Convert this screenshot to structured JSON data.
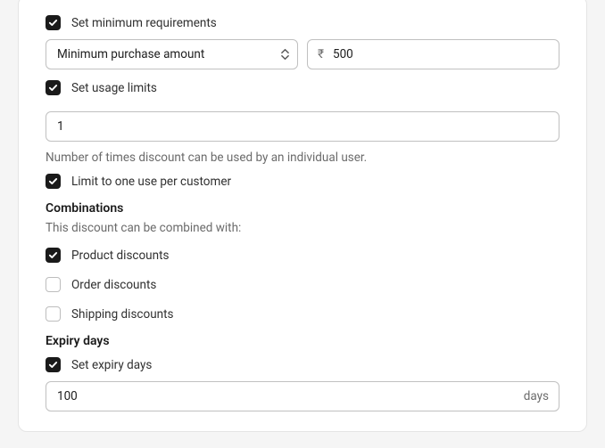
{
  "min_requirements": {
    "label": "Set minimum requirements",
    "checked": true,
    "select_value": "Minimum purchase amount",
    "currency_symbol": "₹",
    "amount": "500"
  },
  "usage_limits": {
    "label": "Set usage limits",
    "checked": true,
    "value": "1",
    "help": "Number of times discount can be used by an individual user."
  },
  "limit_one": {
    "label": "Limit to one use per customer",
    "checked": true
  },
  "combinations": {
    "title": "Combinations",
    "subtitle": "This discount can be combined with:",
    "items": [
      {
        "label": "Product discounts",
        "checked": true
      },
      {
        "label": "Order discounts",
        "checked": false
      },
      {
        "label": "Shipping discounts",
        "checked": false
      }
    ]
  },
  "expiry": {
    "title": "Expiry days",
    "set_label": "Set expiry days",
    "checked": true,
    "value": "100",
    "suffix": "days"
  }
}
